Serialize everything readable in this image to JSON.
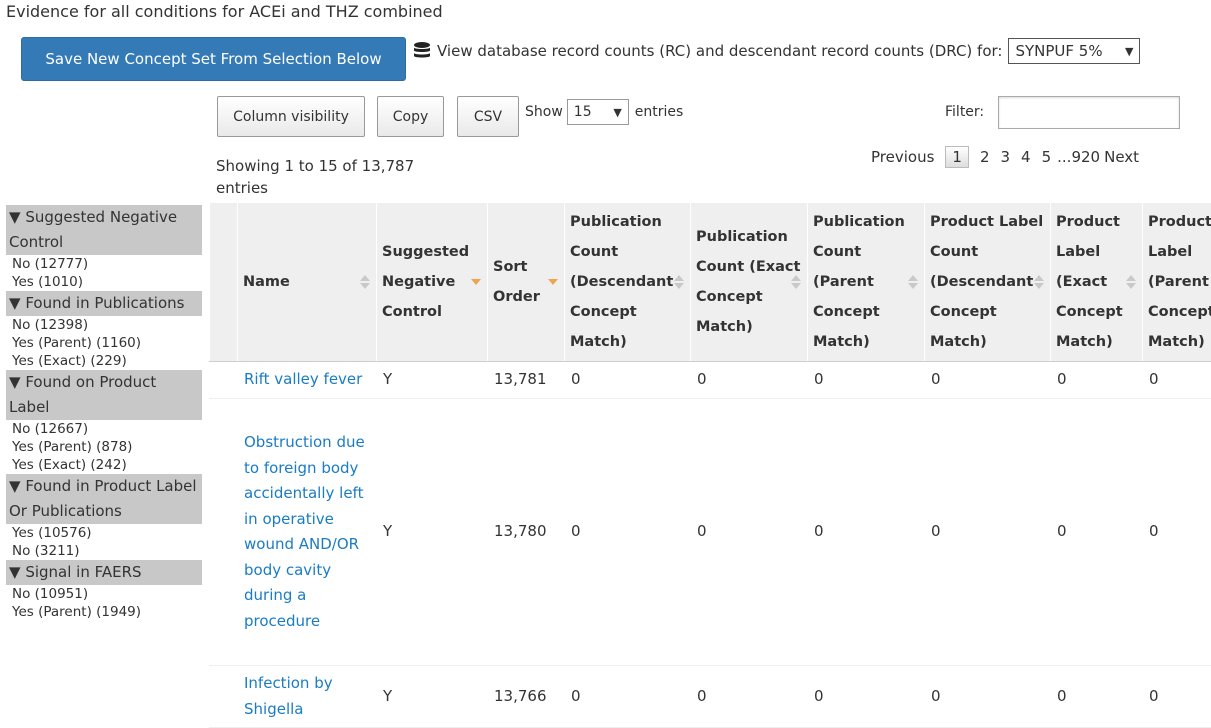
{
  "page": {
    "title": "Evidence for all conditions for ACEi and THZ combined"
  },
  "toolbar": {
    "save_label": "Save New Concept Set From Selection Below",
    "db_text": "View database record counts (RC) and descendant record counts (DRC) for:",
    "source_value": "SYNPUF 5%"
  },
  "table_controls": {
    "column_visibility": "Column visibility",
    "copy": "Copy",
    "csv": "CSV",
    "show_label": "Show",
    "length_value": "15",
    "entries_label": "entries",
    "filter_label": "Filter:",
    "filter_value": "",
    "info": "Showing 1 to 15 of 13,787 entries"
  },
  "pagination": {
    "previous": "Previous",
    "pages": [
      "1",
      "2",
      "3",
      "4",
      "5"
    ],
    "ellipsis": "...",
    "last": "920",
    "next": "Next"
  },
  "facets": [
    {
      "title": "Suggested Negative Control",
      "items": [
        "No (12777)",
        "Yes (1010)"
      ]
    },
    {
      "title": "Found in Publications",
      "items": [
        "No (12398)",
        "Yes (Parent) (1160)",
        "Yes (Exact) (229)"
      ]
    },
    {
      "title": "Found on Product Label",
      "items": [
        "No (12667)",
        "Yes (Parent) (878)",
        "Yes (Exact) (242)"
      ]
    },
    {
      "title": "Found in Product Label Or Publications",
      "items": [
        "Yes (10576)",
        "No (3211)"
      ]
    },
    {
      "title": "Signal in FAERS",
      "items": [
        "No (10951)",
        "Yes (Parent) (1949)"
      ]
    }
  ],
  "columns": [
    "Name",
    "Suggested Negative Control",
    "Sort Order",
    "Publication Count (Descendant Concept Match)",
    "Publication Count (Exact Concept Match)",
    "Publication Count (Parent Concept Match)",
    "Product Label Count (Descendant Concept Match)",
    "Product Label (Exact Concept Match)",
    "Product Label (Parent Concept Match)"
  ],
  "rows": [
    {
      "name": "Rift valley fever",
      "suggested": "Y",
      "sort_order": "13,781",
      "pub_desc": "0",
      "pub_exact": "0",
      "pub_parent": "0",
      "label_desc": "0",
      "label_exact": "0",
      "label_parent": "0"
    },
    {
      "name": "Obstruction due to foreign body accidentally left in operative wound AND/OR body cavity during a procedure",
      "suggested": "Y",
      "sort_order": "13,780",
      "pub_desc": "0",
      "pub_exact": "0",
      "pub_parent": "0",
      "label_desc": "0",
      "label_exact": "0",
      "label_parent": "0"
    },
    {
      "name": "Infection by Shigella",
      "suggested": "Y",
      "sort_order": "13,766",
      "pub_desc": "0",
      "pub_exact": "0",
      "pub_parent": "0",
      "label_desc": "0",
      "label_exact": "0",
      "label_parent": "0"
    }
  ],
  "colors": {
    "primary": "#337ab7",
    "link": "#1a7cc4",
    "sort_active": "#f0a450",
    "facet_bg": "#c8c8c8"
  }
}
